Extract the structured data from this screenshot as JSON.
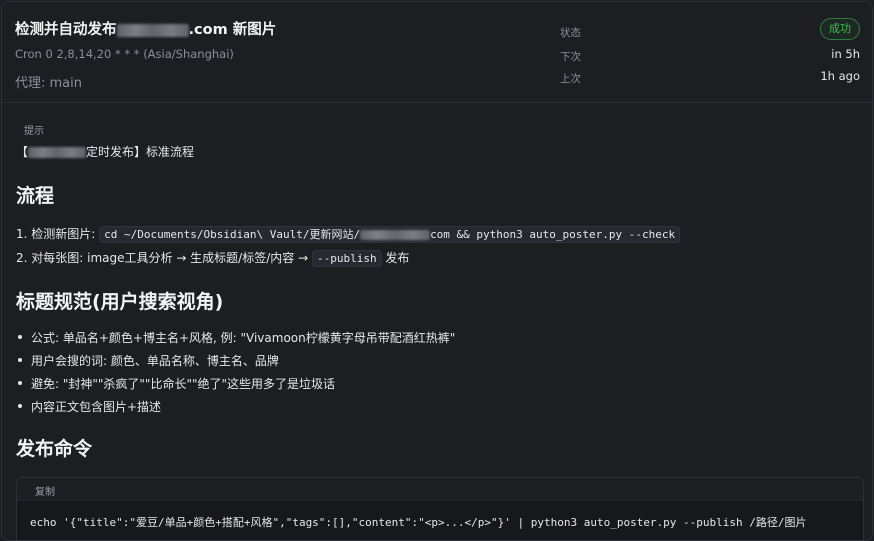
{
  "header": {
    "title_prefix": "检测并自动发布",
    "title_suffix": ".com 新图片",
    "cron": "Cron 0 2,8,14,20 * * * (Asia/Shanghai)",
    "agent": "代理: main",
    "status_label": "状态",
    "status_value": "成功",
    "next_label": "下次",
    "next_value": "in 5h",
    "last_label": "上次",
    "last_value": "1h ago"
  },
  "content": {
    "hint_label": "提示",
    "hint_open": "【",
    "hint_close": "定时发布】标准流程",
    "section1_title": "流程",
    "step1_text": "1. 检测新图片:",
    "step1_code_a": "cd ~/Documents/Obsidian\\ Vault/更新网站/",
    "step1_code_b": "com && python3 auto_poster.py --check",
    "step2_text_a": "2. 对每张图: image工具分析 → 生成标题/标签/内容 →",
    "step2_code": "--publish",
    "step2_text_b": "发布",
    "section2_title": "标题规范(用户搜索视角)",
    "bullets": [
      "公式: 单品名+颜色+博主名+风格, 例: \"Vivamoon柠檬黄字母吊带配酒红热裤\"",
      "用户会搜的词: 颜色、单品名称、博主名、品牌",
      "避免: \"封神\"\"杀疯了\"\"比命长\"\"绝了\"这些用多了是垃圾话",
      "内容正文包含图片+描述"
    ],
    "section3_title": "发布命令",
    "copy_label": "复制",
    "code_line": "echo '{\"title\":\"爱豆/单品+颜色+搭配+风格\",\"tags\":[],\"content\":\"<p>...</p>\"}' | python3 auto_poster.py --publish /路径/图片"
  },
  "colors": {
    "success": "#3fb950",
    "background": "#1c1e22"
  }
}
